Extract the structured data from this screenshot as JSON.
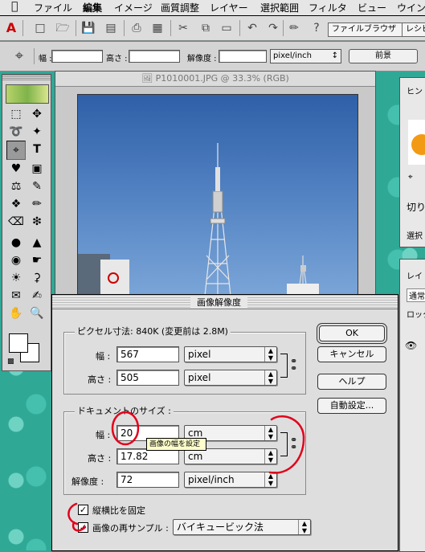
{
  "menubar": {
    "items": [
      "ファイル",
      "編集",
      "イメージ",
      "画質調整",
      "レイヤー",
      "選択範囲",
      "フィルタ",
      "ビュー",
      "ウインドウ"
    ]
  },
  "toolbar": {
    "tabs": [
      "ファイルブラウザ",
      "レシピ"
    ]
  },
  "options_bar": {
    "width_label": "幅 :",
    "height_label": "高さ :",
    "resolution_label": "解像度 :",
    "unit_value": "pixel/inch",
    "front_image_button": "前景"
  },
  "image_window": {
    "title": "P1010001.JPG @ 33.3% (RGB)"
  },
  "right_panels": {
    "top_tab": "ヒン",
    "mid_text1": "切り",
    "mid_text2": "選択",
    "layers_tab": "レイ",
    "layers_mode": "通常",
    "lock_label": "ロック"
  },
  "dialog": {
    "title": "画像解像度",
    "pixel_dimensions": {
      "label": "ピクセル寸法: 840K (変更前は 2.8M)",
      "width_label": "幅 :",
      "width_value": "567",
      "width_unit": "pixel",
      "height_label": "高さ :",
      "height_value": "505",
      "height_unit": "pixel"
    },
    "document_size": {
      "label": "ドキュメントのサイズ :",
      "width_label": "幅 :",
      "width_value": "20",
      "width_unit": "cm",
      "height_label": "高さ :",
      "height_value": "17.82",
      "height_unit": "cm",
      "resolution_label": "解像度 :",
      "resolution_value": "72",
      "resolution_unit": "pixel/inch"
    },
    "tooltip": "画像の幅を設定",
    "constrain_proportions": {
      "label": "縦横比を固定",
      "checked": true
    },
    "resample": {
      "label": "画像の再サンプル :",
      "checked": true,
      "method": "バイキュービック法"
    },
    "buttons": {
      "ok": "OK",
      "cancel": "キャンセル",
      "help": "ヘルプ",
      "auto": "自動設定..."
    }
  },
  "colors": {
    "desktop": "#2fa896",
    "annotation": "#e2001a"
  }
}
